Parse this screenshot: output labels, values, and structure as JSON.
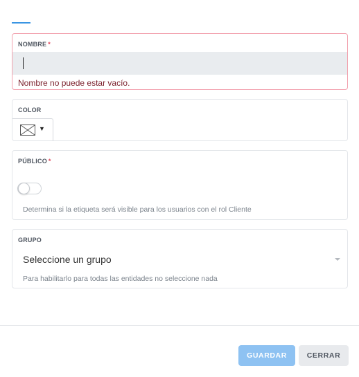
{
  "form": {
    "nombre": {
      "label": "NOMBRE",
      "required_mark": "*",
      "value": "",
      "error": "Nombre no puede estar vacío."
    },
    "color": {
      "label": "COLOR",
      "swatch_icon": "no-color-swatch-icon",
      "caret": "▼"
    },
    "publico": {
      "label": "PÚBLICO",
      "required_mark": "*",
      "enabled": false,
      "help": "Determina si la etiqueta será visible para los usuarios con el rol Cliente"
    },
    "grupo": {
      "label": "GRUPO",
      "placeholder": "Seleccione un grupo",
      "help": "Para habilitarlo para todas las entidades no seleccione nada"
    }
  },
  "actions": {
    "guardar": "GUARDAR",
    "cerrar": "CERRAR"
  },
  "colors": {
    "accent": "#3a95e3",
    "primary_button": "#8ec2f2",
    "error_border": "#f2a0ad",
    "error_text": "#7a1f2b",
    "required": "#e0475b"
  }
}
